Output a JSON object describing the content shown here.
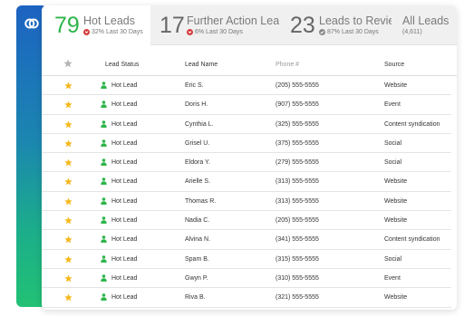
{
  "tabs": [
    {
      "count": "79",
      "label": "Hot Leads",
      "sub": "32% Last 30 Days",
      "trend": "down"
    },
    {
      "count": "17",
      "label": "Further Action Leads",
      "sub": "6% Last 30 Days",
      "trend": "down"
    },
    {
      "count": "23",
      "label": "Leads to Review",
      "sub": "87% Last 30 Days",
      "trend": "check"
    },
    {
      "label": "All Leads",
      "sub": "(4,611)"
    }
  ],
  "table": {
    "headers": {
      "status": "Lead Status",
      "name": "Lead Name",
      "phone": "Phone #",
      "source": "Source"
    },
    "rows": [
      {
        "status": "Hot Lead",
        "name": "Eric S.",
        "phone": "(205) 555-5555",
        "source": "Website"
      },
      {
        "status": "Hot Lead",
        "name": "Doris H.",
        "phone": "(907) 555-5555",
        "source": "Event"
      },
      {
        "status": "Hot Lead",
        "name": "Cynthia L.",
        "phone": "(325) 555-5555",
        "source": "Content syndication"
      },
      {
        "status": "Hot Lead",
        "name": "Grisel U.",
        "phone": "(375) 555-5555",
        "source": "Social"
      },
      {
        "status": "Hot Lead",
        "name": "Eldora Y.",
        "phone": "(279) 555-5555",
        "source": "Social"
      },
      {
        "status": "Hot Lead",
        "name": "Arielle S.",
        "phone": "(313) 555-5555",
        "source": "Website"
      },
      {
        "status": "Hot Lead",
        "name": "Thomas R.",
        "phone": "(313) 555-5555",
        "source": "Website"
      },
      {
        "status": "Hot Lead",
        "name": "Nadia C.",
        "phone": "(205) 555-5555",
        "source": "Website"
      },
      {
        "status": "Hot Lead",
        "name": "Alvina N.",
        "phone": "(341) 555-5555",
        "source": "Content syndication"
      },
      {
        "status": "Hot Lead",
        "name": "Spam B.",
        "phone": "(315) 555-5555",
        "source": "Social"
      },
      {
        "status": "Hot Lead",
        "name": "Gwyn P.",
        "phone": "(310) 555-5555",
        "source": "Event"
      },
      {
        "status": "Hot Lead",
        "name": "Riva B.",
        "phone": "(321) 555-5555",
        "source": "Website"
      }
    ]
  },
  "colors": {
    "accent_green": "#2db54a",
    "star_yellow": "#f5b81b",
    "trend_down": "#d63b3b"
  }
}
